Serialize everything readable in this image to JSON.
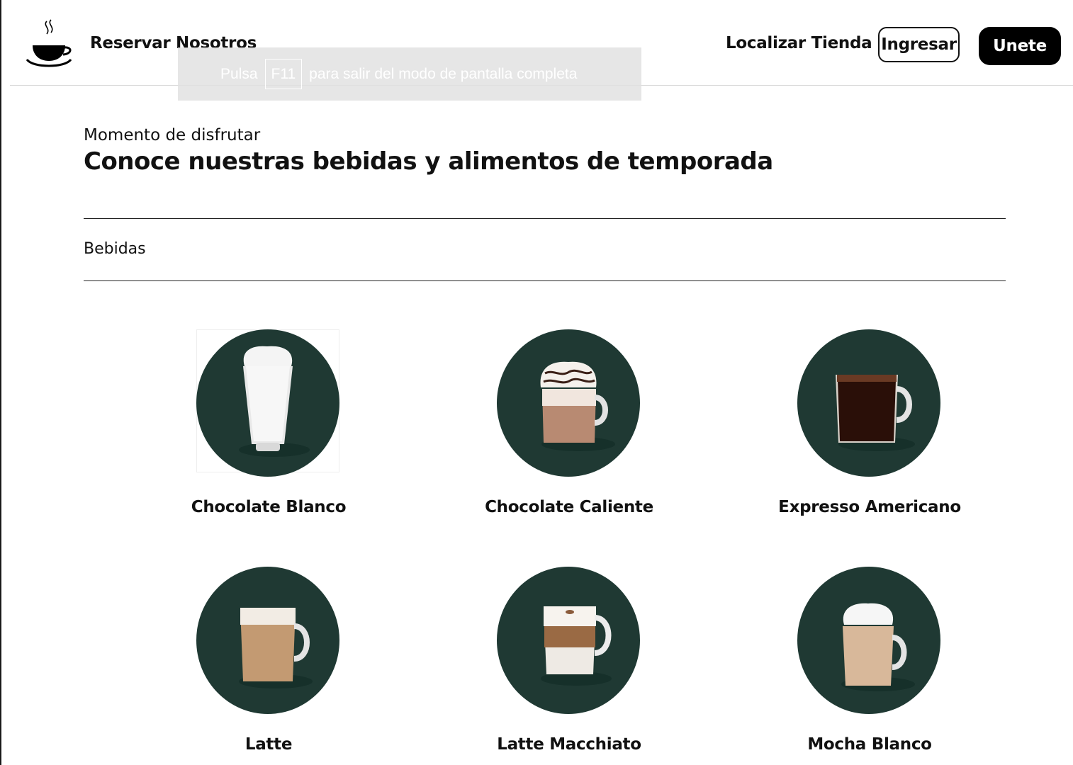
{
  "header": {
    "logo_icon": "coffee-cup-icon",
    "nav": {
      "reservar": "Reservar",
      "nosotros": "Nosotros",
      "localizar": "Localizar Tienda"
    },
    "buttons": {
      "ingresar": "Ingresar",
      "unete": "Unete"
    }
  },
  "fullscreen_notice": {
    "before": "Pulsa",
    "key": "F11",
    "after": "para salir del modo de pantalla completa"
  },
  "hero": {
    "subtitle": "Momento de disfrutar",
    "title": "Conoce nuestras bebidas y alimentos de temporada"
  },
  "section": {
    "label": "Bebidas"
  },
  "products": [
    {
      "name": "Chocolate Blanco",
      "icon": "frappe-glass-icon"
    },
    {
      "name": "Chocolate Caliente",
      "icon": "hot-chocolate-mug-icon"
    },
    {
      "name": "Expresso Americano",
      "icon": "americano-mug-icon"
    },
    {
      "name": "Latte",
      "icon": "latte-mug-icon"
    },
    {
      "name": "Latte Macchiato",
      "icon": "macchiato-mug-icon"
    },
    {
      "name": "Mocha Blanco",
      "icon": "mocha-mug-icon"
    }
  ],
  "colors": {
    "circle_bg": "#1f3933",
    "accent_black": "#000000",
    "text": "#111111"
  }
}
